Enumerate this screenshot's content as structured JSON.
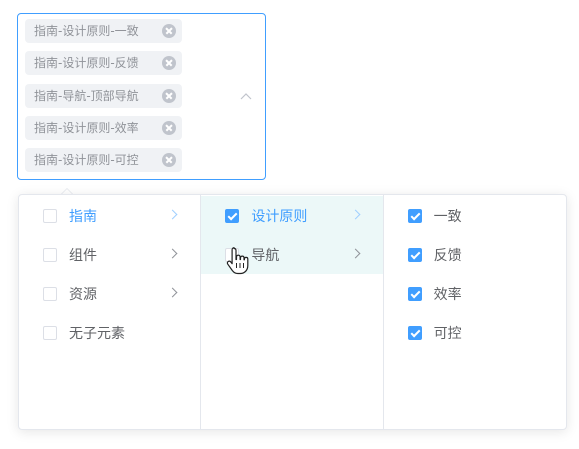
{
  "cascader": {
    "tags": [
      "指南-设计原则-一致",
      "指南-设计原则-反馈",
      "指南-导航-顶部导航",
      "指南-设计原则-效率",
      "指南-设计原则-可控"
    ]
  },
  "columns": [
    [
      {
        "label": "指南",
        "checked": false,
        "has_children": true,
        "active": true
      },
      {
        "label": "组件",
        "checked": false,
        "has_children": true
      },
      {
        "label": "资源",
        "checked": false,
        "has_children": true
      },
      {
        "label": "无子元素",
        "checked": false,
        "has_children": false
      }
    ],
    [
      {
        "label": "设计原则",
        "checked": true,
        "has_children": true,
        "active": true
      },
      {
        "label": "导航",
        "checked": false,
        "has_children": true,
        "hover": true
      }
    ],
    [
      {
        "label": "一致",
        "checked": true
      },
      {
        "label": "反馈",
        "checked": true
      },
      {
        "label": "效率",
        "checked": true
      },
      {
        "label": "可控",
        "checked": true
      }
    ]
  ],
  "colors": {
    "primary": "#409eff",
    "border": "#e4e7ed",
    "tag_bg": "#f0f2f5",
    "highlight_bg": "#ecf8f8"
  },
  "icons": {
    "tag_close": "circle-close-icon",
    "dropdown_toggle": "chevron-up-icon",
    "submenu": "chevron-right-icon",
    "cursor": "hand-pointer-icon"
  }
}
